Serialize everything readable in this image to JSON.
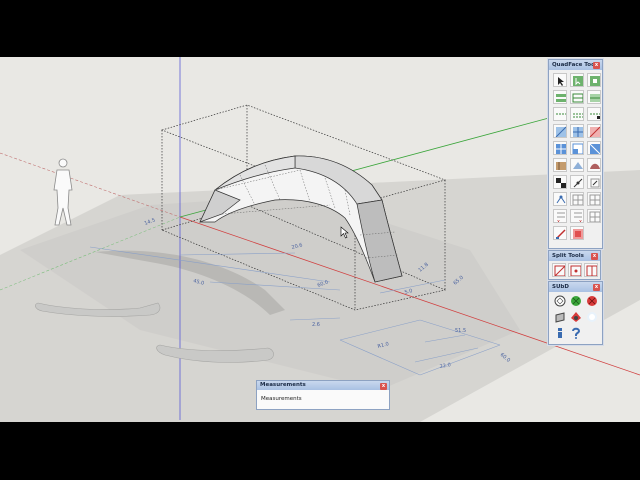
{
  "palettes": {
    "quadface": {
      "title": "QuadFace Tools",
      "close": "x"
    },
    "split": {
      "title": "Split Tools",
      "close": "x"
    },
    "subd": {
      "title": "SUbD",
      "close": "x"
    }
  },
  "measurements": {
    "title": "Measurements",
    "close": "x",
    "label": "Measurements"
  },
  "dimensions": [
    "60.0",
    "20.6",
    "65.0",
    "11.8",
    "45.0",
    "14.5",
    "2.6",
    "60.0",
    "22.0",
    "51.5",
    "R1.0",
    "5.0"
  ],
  "colors": {
    "background": "#e9e8e4",
    "toolbar_header": "#b7cbe8",
    "red_axis": "#d04040",
    "green_axis": "#3aa53a",
    "blue_axis": "#4a4ad0"
  }
}
